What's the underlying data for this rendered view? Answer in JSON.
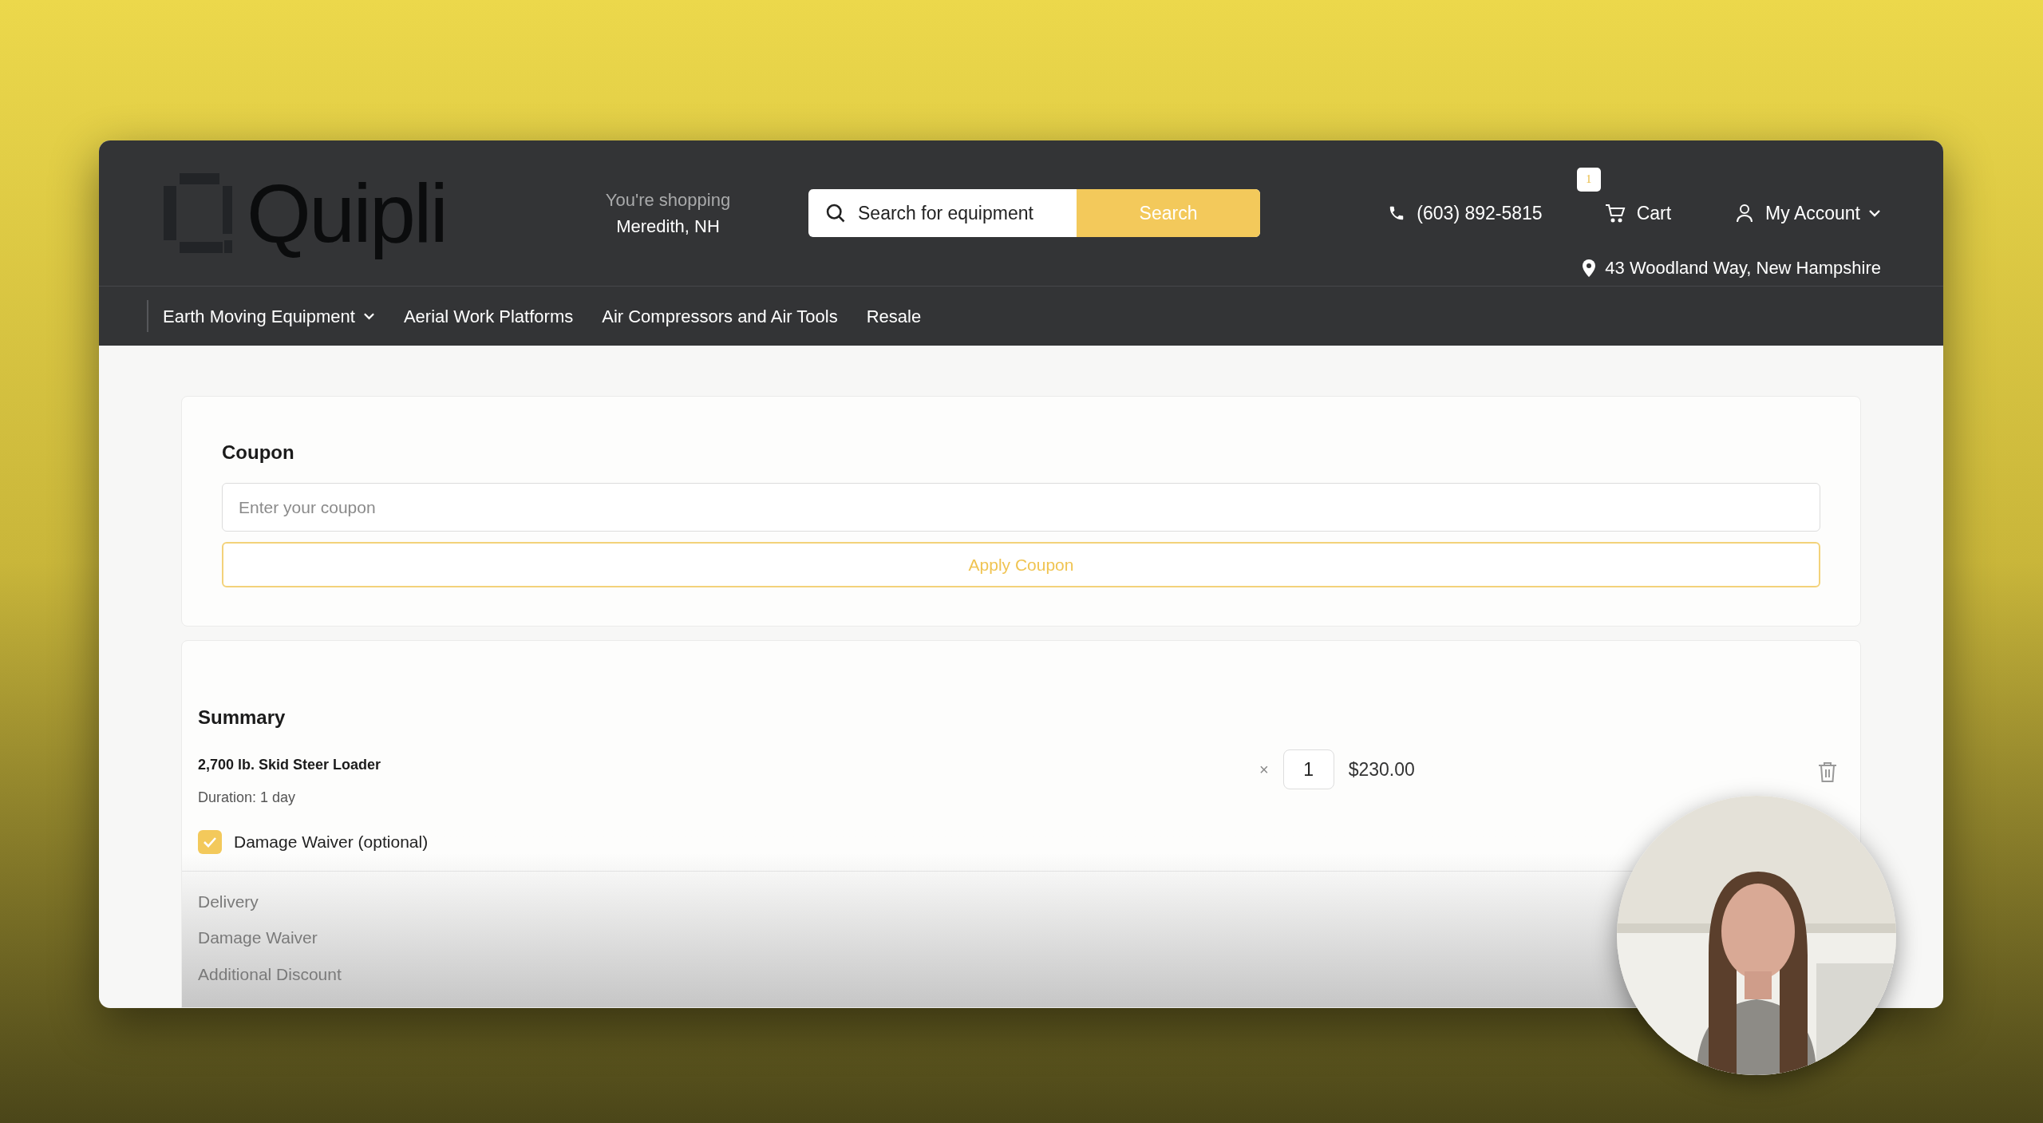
{
  "header": {
    "logo": "Quipli",
    "shopping_label": "You're shopping",
    "location": "Meredith, NH",
    "search": {
      "placeholder": "Search for equipment",
      "button": "Search"
    },
    "phone": "(603) 892-5815",
    "cart": {
      "label": "Cart",
      "badge": "1"
    },
    "account": "My Account",
    "address": "43 Woodland Way, New Hampshire"
  },
  "nav": [
    {
      "label": "Earth Moving Equipment",
      "dropdown": true
    },
    {
      "label": "Aerial Work Platforms",
      "dropdown": false
    },
    {
      "label": "Air Compressors and Air Tools",
      "dropdown": false
    },
    {
      "label": "Resale",
      "dropdown": false
    }
  ],
  "coupon": {
    "title": "Coupon",
    "placeholder": "Enter your coupon",
    "button": "Apply Coupon"
  },
  "summary": {
    "title": "Summary",
    "items": [
      {
        "name": "2,700 lb. Skid Steer Loader",
        "duration": "Duration: 1 day",
        "multiplier": "×",
        "quantity": "1",
        "price": "$230.00"
      }
    ],
    "damage_waiver": {
      "label": "Damage Waiver (optional)",
      "checked": true
    },
    "lines": [
      {
        "label": "Delivery"
      },
      {
        "label": "Damage Waiver"
      },
      {
        "label": "Additional Discount"
      }
    ]
  }
}
